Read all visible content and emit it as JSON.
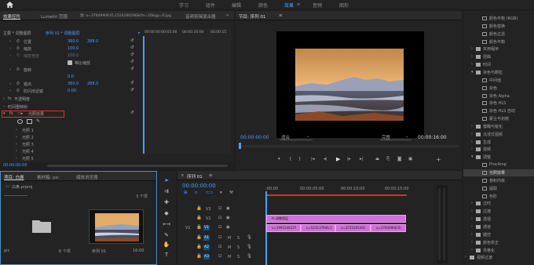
{
  "topnav": {
    "items": [
      "学习",
      "组件",
      "编辑",
      "颜色",
      "效果",
      "音频",
      "图形"
    ],
    "active_index": 4
  },
  "effect_controls": {
    "tabs": [
      "效果控件",
      "Lumetri 范围",
      "源: u=3784990635,1524260296&fm=26&gp=0.jpg",
      "音频剪辑混合器"
    ],
    "breadcrumb_main": "主要 * 调整图层",
    "breadcrumb_seq": "序列 01 * 调整图层",
    "rows": [
      {
        "label": "位置",
        "v1": "360.0",
        "v2": "288.0"
      },
      {
        "label": "缩放",
        "v1": "100.0",
        "v2": ""
      },
      {
        "label": "缩放宽度",
        "v1": "100.0",
        "v2": ""
      },
      {
        "label": "等比缩放",
        "v1": "",
        "v2": ""
      },
      {
        "label": "旋转",
        "v1": "0.0",
        "v2": ""
      },
      {
        "label": "锚点",
        "v1": "360.0",
        "v2": "288.0"
      },
      {
        "label": "防闪烁滤镜",
        "v1": "0.00",
        "v2": ""
      }
    ],
    "opacity_label": "不透明度",
    "time_remap_label": "时间重映射",
    "effect_label": "光照效果",
    "lights": [
      "光照 1",
      "光照 2",
      "光照 3",
      "光照 4",
      "光照 5"
    ],
    "timecode": "00:00:00:00",
    "mini_timeline": {
      "t0": "00:00",
      "t1": "00:00:05:00",
      "t2": "00:00:10:00",
      "t3": "00:00:15"
    }
  },
  "program": {
    "title": "节目: 序列 01",
    "timecode_left": "00:00:00:00",
    "fit": "适合",
    "quality": "完整",
    "timecode_right": "00:00:16:00"
  },
  "project": {
    "tabs": [
      "项目: 白鼻",
      "素材箱: pic",
      "媒体浏览器"
    ],
    "project_file": "白鼻.prproj",
    "items_count": "3 个项",
    "folder_label": "pic",
    "folder_count": "6 个项",
    "sequence_label": "序列 01",
    "sequence_duration": "16:00"
  },
  "effects_tree": {
    "items": [
      {
        "label": "颜色平衡 (RGB)",
        "indent": 2,
        "type": "fx"
      },
      {
        "label": "颜色替换",
        "indent": 2,
        "type": "fx"
      },
      {
        "label": "颜色过滤",
        "indent": 2,
        "type": "fx"
      },
      {
        "label": "颜色平衡",
        "indent": 2,
        "type": "fx"
      },
      {
        "label": "实用程序",
        "indent": 1,
        "type": "folder"
      },
      {
        "label": "扭曲",
        "indent": 1,
        "type": "folder"
      },
      {
        "label": "时间",
        "indent": 1,
        "type": "folder"
      },
      {
        "label": "杂色与颗粒",
        "indent": 1,
        "type": "folder-open"
      },
      {
        "label": "中间值",
        "indent": 2,
        "type": "fx"
      },
      {
        "label": "杂色",
        "indent": 2,
        "type": "fx"
      },
      {
        "label": "杂色 Alpha",
        "indent": 2,
        "type": "fx"
      },
      {
        "label": "杂色 HLS",
        "indent": 2,
        "type": "fx"
      },
      {
        "label": "杂色 HLS 自动",
        "indent": 2,
        "type": "fx"
      },
      {
        "label": "蒙尘与划痕",
        "indent": 2,
        "type": "fx"
      },
      {
        "label": "模糊与锐化",
        "indent": 1,
        "type": "folder"
      },
      {
        "label": "沉浸式视频",
        "indent": 1,
        "type": "folder"
      },
      {
        "label": "生成",
        "indent": 1,
        "type": "folder"
      },
      {
        "label": "视频",
        "indent": 1,
        "type": "folder"
      },
      {
        "label": "调整",
        "indent": 1,
        "type": "folder-open"
      },
      {
        "label": "ProcAmp",
        "indent": 2,
        "type": "fx"
      },
      {
        "label": "光照效果",
        "indent": 2,
        "type": "fx",
        "selected": true
      },
      {
        "label": "卷积内核",
        "indent": 2,
        "type": "fx"
      },
      {
        "label": "提取",
        "indent": 2,
        "type": "fx"
      },
      {
        "label": "色阶",
        "indent": 2,
        "type": "fx"
      },
      {
        "label": "过时",
        "indent": 1,
        "type": "folder"
      },
      {
        "label": "过渡",
        "indent": 1,
        "type": "folder"
      },
      {
        "label": "透视",
        "indent": 1,
        "type": "folder"
      },
      {
        "label": "通道",
        "indent": 1,
        "type": "folder"
      },
      {
        "label": "键控",
        "indent": 1,
        "type": "folder"
      },
      {
        "label": "颜色校正",
        "indent": 1,
        "type": "folder"
      },
      {
        "label": "风格化",
        "indent": 1,
        "type": "folder"
      },
      {
        "label": "视频过渡",
        "indent": 0,
        "type": "folder"
      }
    ]
  },
  "timeline": {
    "title": "序列 01",
    "timecode": "00:00:00:00",
    "ruler": [
      ":00:00",
      "00:00:05:00",
      "00:00:10:00",
      "00:00:15:00"
    ],
    "video_tracks": [
      "V3",
      "V2",
      "V1"
    ],
    "audio_tracks": [
      "A1",
      "A2",
      "A3"
    ],
    "adjustment_clip": "调整图层",
    "v1_clips": [
      "u=1993146237",
      "u=523137946,3",
      "u=3725205281",
      "u=3784990635"
    ],
    "v1_side": "V1",
    "track_letters": {
      "m": "M",
      "s": "S"
    }
  },
  "colors": {
    "accent": "#4d9cff",
    "clip_pink": "#d070d8",
    "selection_red": "#ff3333"
  }
}
